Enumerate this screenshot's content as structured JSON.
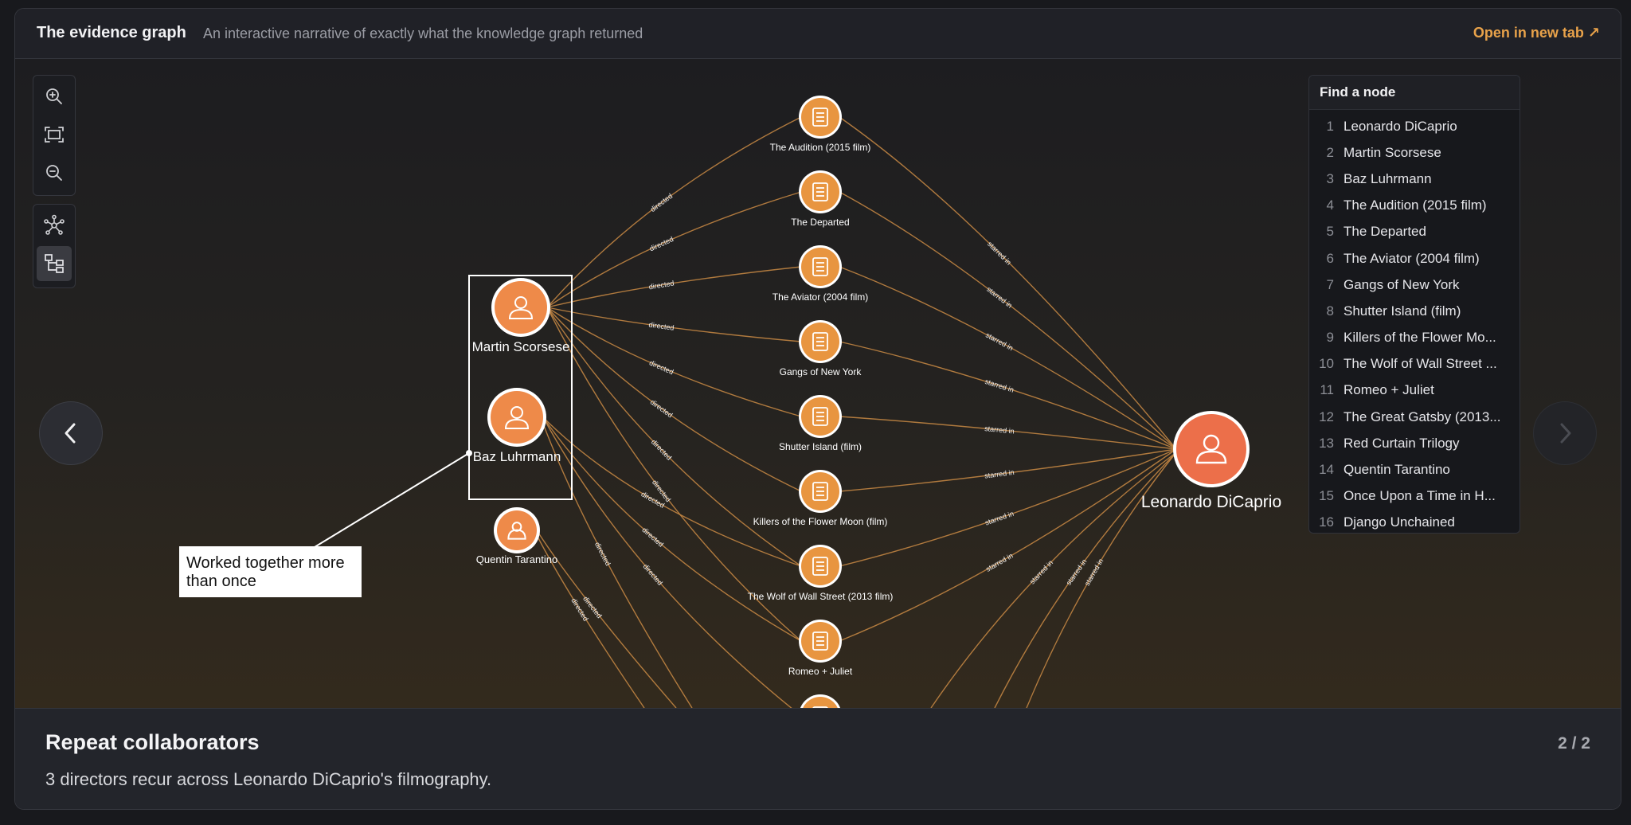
{
  "header": {
    "title": "The evidence graph",
    "subtitle": "An interactive narrative of exactly what the knowledge graph returned",
    "open_new_tab": "Open in new tab ↗"
  },
  "toolbar": {
    "zoom_icons": [
      "zoom-in-icon",
      "fit-view-icon",
      "zoom-out-icon"
    ],
    "layout_icons": [
      "force-layout-icon",
      "hierarchy-layout-icon"
    ],
    "active_layout": "hierarchy-layout-icon"
  },
  "colors": {
    "accent": "#e8a24a",
    "node_person": "#ee8a49",
    "node_film": "#e89540",
    "node_main": "#ec6f4a",
    "edge": "#c98a44"
  },
  "graph": {
    "main_node": "Leonardo DiCaprio",
    "directors": [
      "Martin Scorsese",
      "Baz Luhrmann",
      "Quentin Tarantino"
    ],
    "films": [
      "The Audition (2015 film)",
      "The Departed",
      "The Aviator (2004 film)",
      "Gangs of New York",
      "Shutter Island (film)",
      "Killers of the Flower Moon (film)",
      "The Wolf of Wall Street (2013 film)",
      "Romeo + Juliet",
      ""
    ],
    "edge_directed": "directed",
    "edge_starred": "starred in",
    "annotation": [
      "Worked together more",
      "than once"
    ]
  },
  "finder": {
    "title": "Find a node",
    "items": [
      {
        "num": "1",
        "label": "Leonardo DiCaprio"
      },
      {
        "num": "2",
        "label": "Martin Scorsese"
      },
      {
        "num": "3",
        "label": "Baz Luhrmann"
      },
      {
        "num": "4",
        "label": "The Audition (2015 film)"
      },
      {
        "num": "5",
        "label": "The Departed"
      },
      {
        "num": "6",
        "label": "The Aviator (2004 film)"
      },
      {
        "num": "7",
        "label": "Gangs of New York"
      },
      {
        "num": "8",
        "label": "Shutter Island (film)"
      },
      {
        "num": "9",
        "label": "Killers of the Flower Mo..."
      },
      {
        "num": "10",
        "label": "The Wolf of Wall Street ..."
      },
      {
        "num": "11",
        "label": "Romeo + Juliet"
      },
      {
        "num": "12",
        "label": "The Great Gatsby (2013..."
      },
      {
        "num": "13",
        "label": "Red Curtain Trilogy"
      },
      {
        "num": "14",
        "label": "Quentin Tarantino"
      },
      {
        "num": "15",
        "label": "Once Upon a Time in H..."
      },
      {
        "num": "16",
        "label": "Django Unchained"
      }
    ]
  },
  "footer": {
    "title": "Repeat collaborators",
    "text": "3 directors recur across Leonardo DiCaprio's filmography.",
    "page": "2 / 2"
  }
}
